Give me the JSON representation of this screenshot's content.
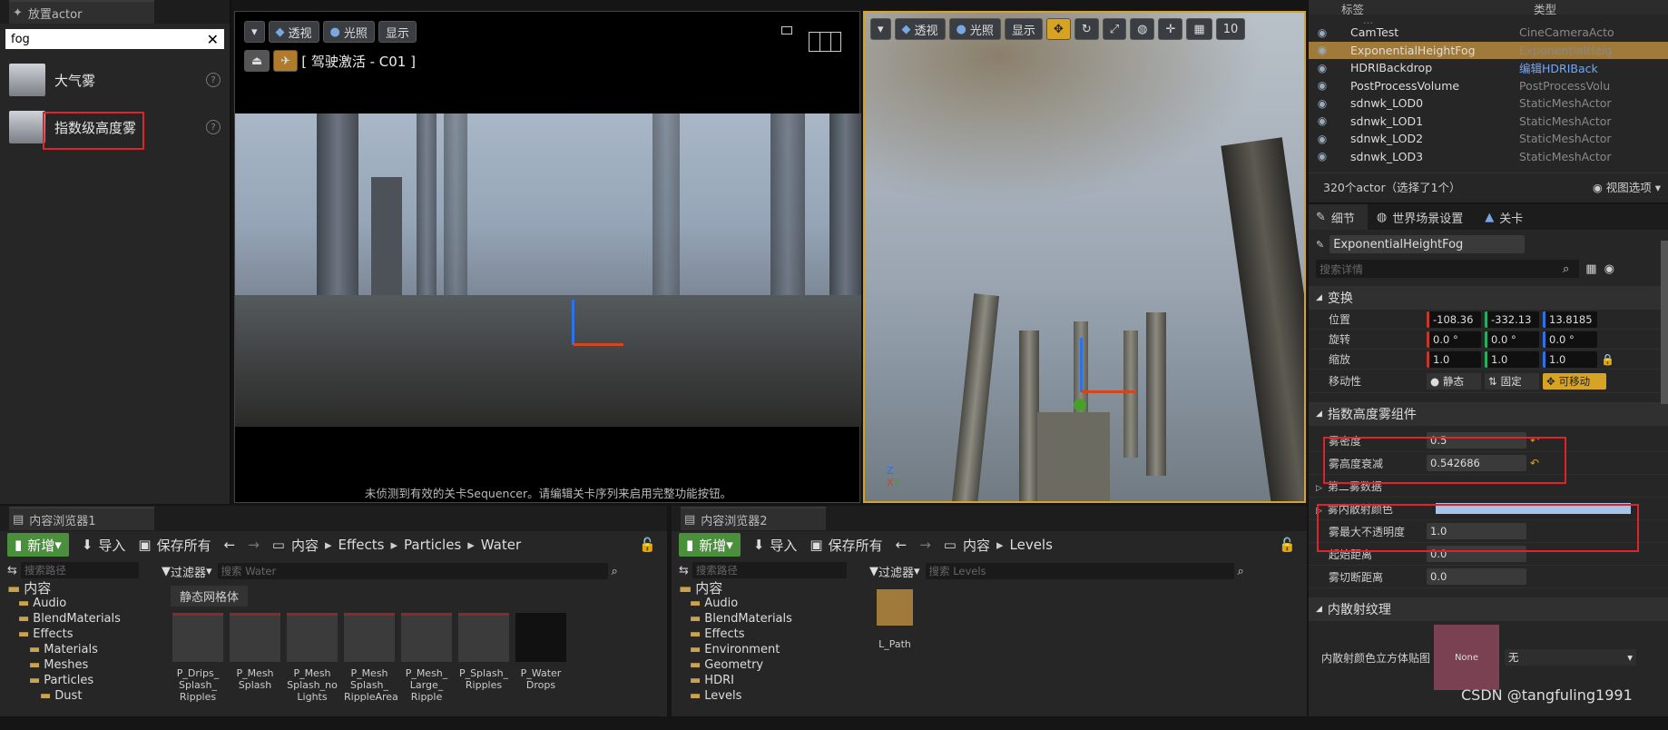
{
  "place": {
    "tab": "放置actor",
    "search": "fog",
    "items": [
      {
        "label": "大气雾"
      },
      {
        "label": "指数级高度雾"
      }
    ]
  },
  "vp1": {
    "btn_persp": "透视",
    "btn_lit": "光照",
    "btn_show": "显示",
    "cam_label": "[ 驾驶激活 - C01 ]",
    "notice": "未侦测到有效的关卡Sequencer。请编辑关卡序列来启用完整功能按钮。"
  },
  "vp2": {
    "btn_persp": "透视",
    "btn_lit": "光照",
    "btn_show": "显示",
    "grid_val": "10"
  },
  "outliner": {
    "col_label": "标签",
    "col_type": "类型",
    "rows": [
      {
        "name": "CamTest",
        "type": "CineCameraActo"
      },
      {
        "name": "ExponentialHeightFog",
        "type": "ExponentialHeig"
      },
      {
        "name": "HDRIBackdrop",
        "type": "编辑HDRIBack"
      },
      {
        "name": "PostProcessVolume",
        "type": "PostProcessVolu"
      },
      {
        "name": "sdnwk_LOD0",
        "type": "StaticMeshActor"
      },
      {
        "name": "sdnwk_LOD1",
        "type": "StaticMeshActor"
      },
      {
        "name": "sdnwk_LOD2",
        "type": "StaticMeshActor"
      },
      {
        "name": "sdnwk_LOD3",
        "type": "StaticMeshActor"
      }
    ],
    "count": "320个actor（选择了1个）",
    "view_options": "视图选项"
  },
  "details": {
    "tabs": [
      "细节",
      "世界场景设置",
      "关卡"
    ],
    "actor_name": "ExponentialHeightFog",
    "search_ph": "搜索详情",
    "transform": "变换",
    "loc_label": "位置",
    "rot_label": "旋转",
    "scale_label": "缩放",
    "mob_label": "移动性",
    "loc": [
      "-108.36",
      "-332.13",
      "13.8185"
    ],
    "rot": [
      "0.0 °",
      "0.0 °",
      "0.0 °"
    ],
    "scale": [
      "1.0",
      "1.0",
      "1.0"
    ],
    "mob": [
      "静态",
      "固定",
      "可移动"
    ],
    "fog_comp": "指数高度雾组件",
    "density_label": "雾密度",
    "density": "0.5",
    "falloff_label": "雾高度衰减",
    "falloff": "0.542686",
    "second": "第二雾数据",
    "inscat_label": "雾内散射颜色",
    "maxop_label": "雾最大不透明度",
    "maxop": "1.0",
    "start_label": "起始距离",
    "start": "0.0",
    "cutoff_label": "雾切断距离",
    "cutoff": "0.0",
    "inscat_tex": "内散射纹理",
    "cubemap_label": "内散射颜色立方体贴图",
    "none_thumb": "None",
    "none_select": "无",
    "accent": "#d7a324"
  },
  "cb1": {
    "tab": "内容浏览器1",
    "add": "新增",
    "import": "导入",
    "save": "保存所有",
    "crumbs": [
      "内容",
      "Effects",
      "Particles",
      "Water"
    ],
    "path_ph": "搜索路径",
    "filter": "过滤器",
    "search_ph": "搜索 Water",
    "group": "静态网格体",
    "tree": [
      "内容",
      "Audio",
      "BlendMaterials",
      "Effects",
      "Materials",
      "Meshes",
      "Particles",
      "Dust"
    ],
    "assets": [
      "P_Drips_\nSplash_\nRipples",
      "P_Mesh\nSplash",
      "P_Mesh\nSplash_no\nLights",
      "P_Mesh\nSplash_\nRippleArea",
      "P_Mesh_\nLarge_\nRipple",
      "P_Splash_\nRipples",
      "P_Water\nDrops"
    ]
  },
  "cb2": {
    "tab": "内容浏览器2",
    "add": "新增",
    "import": "导入",
    "save": "保存所有",
    "crumbs": [
      "内容",
      "Levels"
    ],
    "path_ph": "搜索路径",
    "filter": "过滤器",
    "search_ph": "搜索 Levels",
    "tree": [
      "内容",
      "Audio",
      "BlendMaterials",
      "Effects",
      "Environment",
      "Geometry",
      "HDRI",
      "Levels"
    ],
    "asset": "L_Path"
  },
  "watermark": "CSDN @tangfuling1991"
}
